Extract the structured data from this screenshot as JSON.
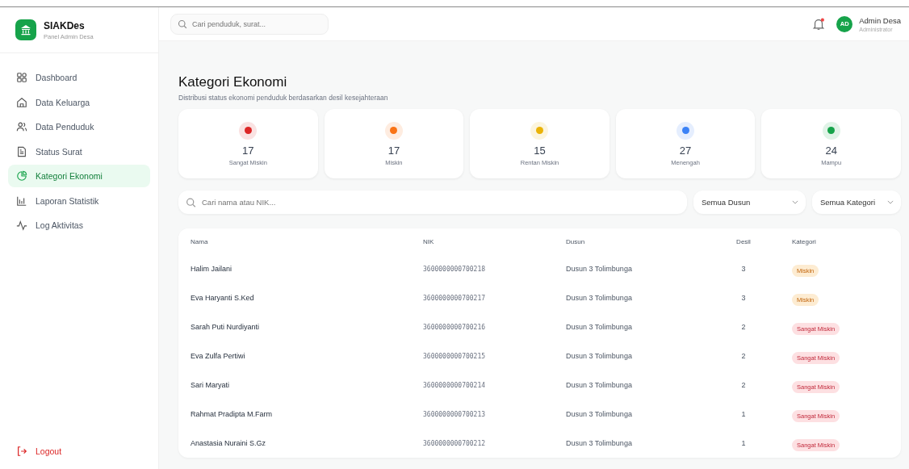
{
  "brand": {
    "name": "SIAKDes",
    "subtitle": "Panel Admin Desa"
  },
  "sidebar": {
    "items": [
      {
        "label": "Dashboard",
        "kind": "grid",
        "selected": false
      },
      {
        "label": "Data Keluarga",
        "kind": "home",
        "selected": false
      },
      {
        "label": "Data Penduduk",
        "kind": "users",
        "selected": false
      },
      {
        "label": "Status Surat",
        "kind": "file",
        "selected": false
      },
      {
        "label": "Kategori Ekonomi",
        "kind": "pie",
        "selected": true
      },
      {
        "label": "Laporan Statistik",
        "kind": "bars",
        "selected": false
      },
      {
        "label": "Log Aktivitas",
        "kind": "pulse",
        "selected": false
      }
    ],
    "logout": "Logout"
  },
  "header": {
    "search": {
      "placeholder": "Cari penduduk, surat..."
    },
    "notifications": {
      "unread": true
    },
    "user": {
      "initials": "AD",
      "name": "Admin Desa",
      "role": "Administrator"
    }
  },
  "page": {
    "title": "Kategori Ekonomi",
    "subtitle": "Distribusi status ekonomi penduduk berdasarkan desil kesejahteraan"
  },
  "stats": [
    {
      "value": "17",
      "label": "Sangat Miskin",
      "color": "#dc2626"
    },
    {
      "value": "17",
      "label": "Miskin",
      "color": "#f97316"
    },
    {
      "value": "15",
      "label": "Rentan Miskin",
      "color": "#eab308"
    },
    {
      "value": "27",
      "label": "Menengah",
      "color": "#3b82f6"
    },
    {
      "value": "24",
      "label": "Mampu",
      "color": "#16a34a"
    }
  ],
  "filters": {
    "search": {
      "placeholder": "Cari nama atau NIK..."
    },
    "dropdowns": [
      "Semua Dusun",
      "Semua Kategori"
    ]
  },
  "table": {
    "columns": [
      "Nama",
      "NIK",
      "Dusun",
      "Desil",
      "Kategori"
    ],
    "rows": [
      {
        "nama": "Halim Jailani",
        "nik": "3600000000700218",
        "dusun": "Dusun 3 Tolimbunga",
        "desil": "3",
        "kategori": "Miskin",
        "kind": "miskin"
      },
      {
        "nama": "Eva Haryanti S.Ked",
        "nik": "3600000000700217",
        "dusun": "Dusun 3 Tolimbunga",
        "desil": "3",
        "kategori": "Miskin",
        "kind": "miskin"
      },
      {
        "nama": "Sarah Puti Nurdiyanti",
        "nik": "3600000000700216",
        "dusun": "Dusun 3 Tolimbunga",
        "desil": "2",
        "kategori": "Sangat Miskin",
        "kind": "sangat-miskin"
      },
      {
        "nama": "Eva Zulfa Pertiwi",
        "nik": "3600000000700215",
        "dusun": "Dusun 3 Tolimbunga",
        "desil": "2",
        "kategori": "Sangat Miskin",
        "kind": "sangat-miskin"
      },
      {
        "nama": "Sari Maryati",
        "nik": "3600000000700214",
        "dusun": "Dusun 3 Tolimbunga",
        "desil": "2",
        "kategori": "Sangat Miskin",
        "kind": "sangat-miskin"
      },
      {
        "nama": "Rahmat Pradipta M.Farm",
        "nik": "3600000000700213",
        "dusun": "Dusun 3 Tolimbunga",
        "desil": "1",
        "kategori": "Sangat Miskin",
        "kind": "sangat-miskin"
      },
      {
        "nama": "Anastasia Nuraini S.Gz",
        "nik": "3600000000700212",
        "dusun": "Dusun 3 Tolimbunga",
        "desil": "1",
        "kategori": "Sangat Miskin",
        "kind": "sangat-miskin"
      }
    ]
  }
}
